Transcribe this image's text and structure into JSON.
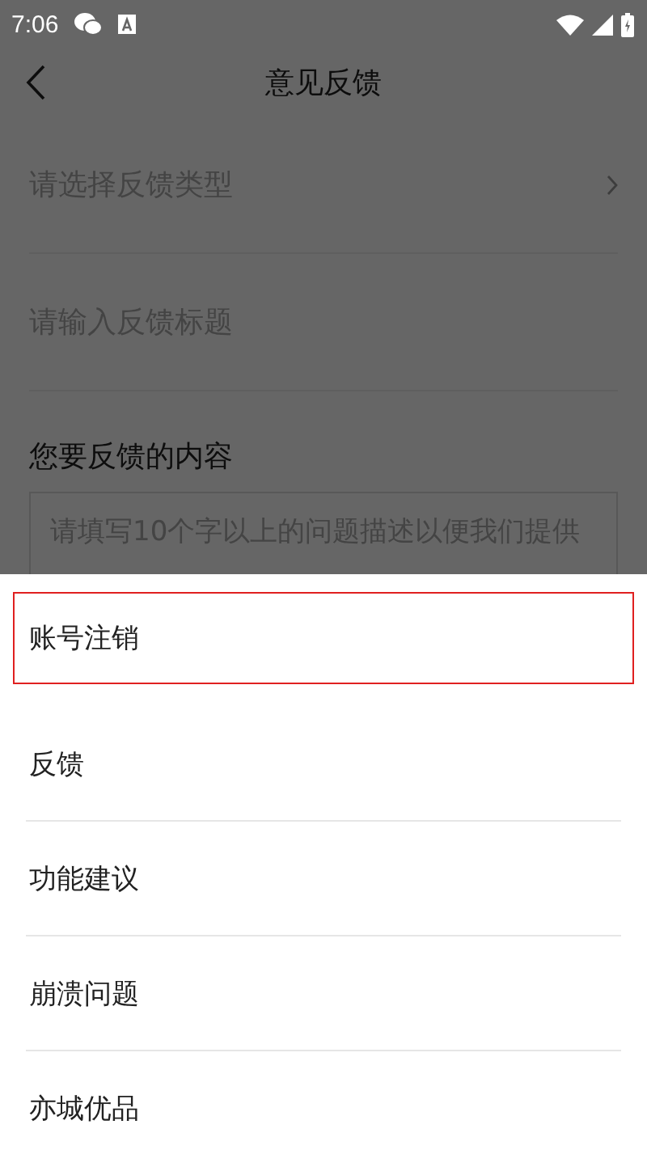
{
  "status_bar": {
    "time": "7:06"
  },
  "header": {
    "title": "意见反馈"
  },
  "form": {
    "type_placeholder": "请选择反馈类型",
    "title_placeholder": "请输入反馈标题",
    "content_heading": "您要反馈的内容",
    "content_placeholder": "请填写10个字以上的问题描述以便我们提供"
  },
  "sheet": {
    "options": [
      {
        "label": "账号注销",
        "selected": true
      },
      {
        "label": "反馈",
        "selected": false
      },
      {
        "label": "功能建议",
        "selected": false
      },
      {
        "label": "崩溃问题",
        "selected": false
      },
      {
        "label": "亦城优品",
        "selected": false
      }
    ]
  }
}
